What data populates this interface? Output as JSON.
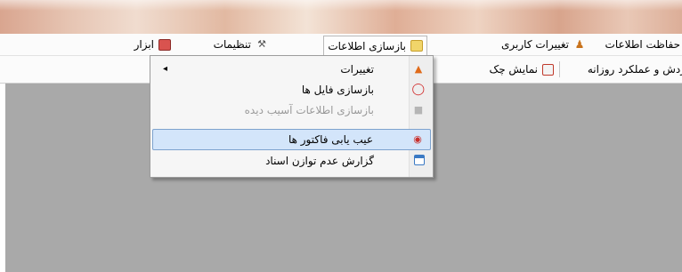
{
  "menubar": {
    "items": [
      {
        "label": "حفاظت اطلاعات",
        "icon": "lock-icon"
      },
      {
        "label": "تغییرات کاربری",
        "icon": "users-icon"
      },
      {
        "label": "بازسازی اطلاعات",
        "icon": "folder-tools-icon"
      },
      {
        "label": "تنظیمات",
        "icon": "tools-icon"
      },
      {
        "label": "ابزار",
        "icon": "toolbox-icon"
      }
    ]
  },
  "toolbar": {
    "items": [
      {
        "label": "ردش و عملکرد روزانه"
      },
      {
        "label": "نمایش چک",
        "icon": "calendar-icon"
      }
    ]
  },
  "dropdown": {
    "items": [
      {
        "label": "تغییرات",
        "icon": "cone-icon",
        "has_submenu": true
      },
      {
        "label": "بازسازی فایل ها",
        "icon": "lifebuoy-icon"
      },
      {
        "label": "بازسازی اطلاعات آسیب دیده",
        "icon": "shield-icon",
        "disabled": true
      },
      {
        "label": "عیب یابی فاکتور ها",
        "icon": "bug-icon",
        "highlighted": true
      },
      {
        "label": "گزارش عدم توازن اسناد",
        "icon": "window-icon"
      }
    ],
    "submenu_arrow": "◂"
  },
  "colors": {
    "workspace": "#a9a9a9",
    "highlight": "#d3e5fa",
    "highlight_border": "#7da2ce"
  }
}
